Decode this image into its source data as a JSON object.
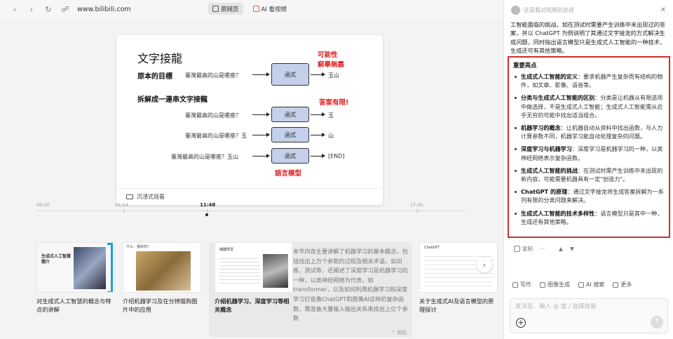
{
  "browser": {
    "url": "www.bilibili.com",
    "tabs": [
      {
        "label": "原网页",
        "active": true
      },
      {
        "label": "AI 看视频",
        "active": false
      }
    ]
  },
  "slide": {
    "title": "文字接龍",
    "note_possibility": "可能性",
    "note_infinite": "窮舉無盡",
    "goal_label": "原本的目標",
    "goal_question": "臺灣最高的山是哪座？",
    "function_label": "函式",
    "goal_output": "玉山",
    "split_label": "拆解成一連串文字接龍",
    "note_answer_limited": "答案有限!",
    "steps": [
      {
        "input": "臺灣最高的山是哪座？",
        "output": "玉"
      },
      {
        "input": "臺灣最高的山是哪座？玉",
        "output": "山"
      },
      {
        "input": "臺灣最高的山是哪座？玉山",
        "output": "[END]"
      }
    ],
    "language_model_label": "語言模型",
    "immersive_label": "沉浸式观看"
  },
  "timeline": {
    "labels": [
      "00:00",
      "05:54",
      "11:48",
      "17:41"
    ],
    "current": "11:48"
  },
  "chapters": [
    {
      "title": "对生成式人工智慧的概念与特点的讲解",
      "thumb_heading": "生成式人工智慧簡介"
    },
    {
      "title": "介绍机器学习及在分辨猫狗图片中的应用",
      "thumb_heading": "什么：猫和狗？"
    },
    {
      "title": "介绍机器学习、深度学习等相关概念",
      "thumb_heading": "機器學習",
      "active": true
    },
    {
      "title": "关于生成式AI及语言模型的原理探讨",
      "thumb_heading": "ChatGPT"
    }
  ],
  "active_chapter_desc": "本节内容主要讲解了机器学习的基本概念，包括找出上万个参数的过程及相关术语，如训练、测试等，还阐述了深度学习是机器学习的一种，以类神经网络为代表，如transformer，以及如何利用机器学习和深度学习打造像ChatGPT和图像AI这样的复杂函数，需准备大量输入输出关系来找出上亿个参数",
  "collapse_label": "收起",
  "panel": {
    "header": "这是我对视频的总结",
    "intro": "工智能面临的挑战，如在测试时需要产生训练中未出现过的答案，并以 ChatGPT 为例说明了其通过文字接龙的方式解决生成问题，同时指出语言模型只是生成式人工智能的一种技术，生成还可有其他策略。",
    "highlights_title": "重要亮点",
    "highlights": [
      {
        "term": "生成式人工智能的定义",
        "text": "：要求机器产生复杂而有结构的物件，如文章、影像、语音等。"
      },
      {
        "term": "分类与生成式人工智能的区别",
        "text": "：分类是让机器从有限选项中做选择，不是生成式人工智能；生成式人工智能需从近乎无穷的可能中找出适当组合。"
      },
      {
        "term": "机器学习的概念",
        "text": "：让机器自动从资料中找出函数，与人力计算参数不同，机器学习能自动处理复杂的问题。"
      },
      {
        "term": "深度学习与机器学习",
        "text": "：深度学习是机器学习的一种，以类神经网络表示复杂函数。"
      },
      {
        "term": "生成式人工智能的挑战",
        "text": "：在测试时需产生训练中未出现的新内容，可能需要机器具有一定\"创造力\"。"
      },
      {
        "term": "ChatGPT 的原理",
        "text": "：通过文字接龙将生成答案拆解为一系列有限的分类问题来解决。"
      },
      {
        "term": "生成式人工智能的技术多样性",
        "text": "：语言模型只是其中一种，生成还有其他策略。"
      }
    ],
    "actions": {
      "copy": "复制",
      "more": "···"
    },
    "chips": [
      "写作",
      "图像生成",
      "AI 搜索",
      "更多"
    ],
    "input_placeholder": "发消息、输入 @ 或 / 选择技能"
  }
}
